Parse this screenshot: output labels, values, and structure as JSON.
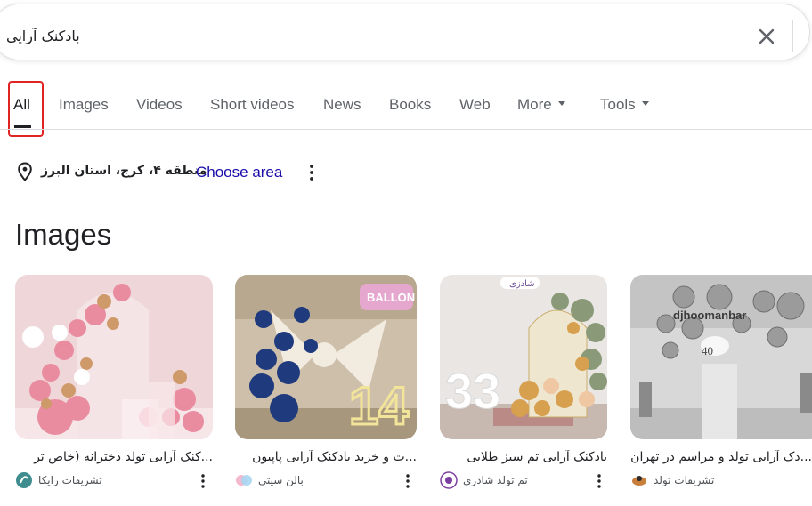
{
  "search": {
    "query": "بادکنک آرایی",
    "clear_icon": "close-icon"
  },
  "tabs": [
    {
      "label": "All",
      "active": true
    },
    {
      "label": "Images"
    },
    {
      "label": "Videos"
    },
    {
      "label": "Short videos"
    },
    {
      "label": "News"
    },
    {
      "label": "Books"
    },
    {
      "label": "Web"
    },
    {
      "label": "More",
      "dropdown": true
    },
    {
      "label": "Tools",
      "dropdown": true
    }
  ],
  "location": {
    "icon": "location-pin-icon",
    "text": "منطقه ۴، کرج، استان البرز",
    "separator": "·",
    "choose_area": "Choose area"
  },
  "images_section": {
    "heading": "Images",
    "cards": [
      {
        "title": "...کنک آرایی تولد دخترانه (خاص تر",
        "source": "تشریفات رایکا",
        "palette": "pink"
      },
      {
        "title": "...ت و خرید بادکنک آرایی پاپیون",
        "source": "بالن سیتی",
        "palette": "navy-gold"
      },
      {
        "title": "بادکنک آرایی تم سبز طلایی",
        "source": "تم تولد شادزی",
        "palette": "sage-gold"
      },
      {
        "title": "...دک آرایی تولد و مراسم در تهران",
        "source": "تشریفات تولد",
        "palette": "silver"
      }
    ]
  },
  "colors": {
    "link": "#1a0dab",
    "highlight": "#e02424",
    "tab_text": "#5f6368"
  }
}
